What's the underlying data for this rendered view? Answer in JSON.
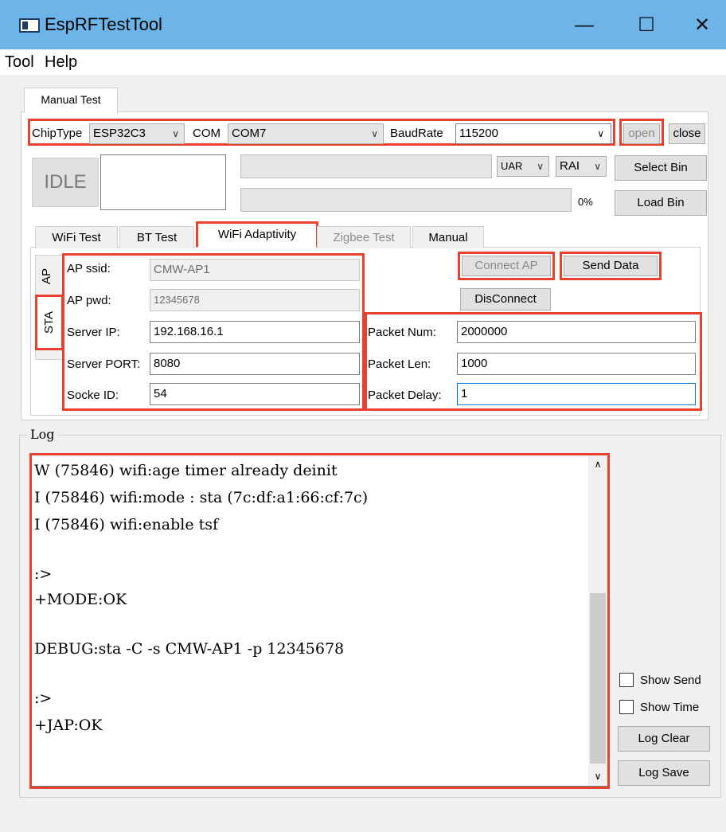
{
  "window": {
    "title": "EspRFTestTool",
    "minimize": "—",
    "maximize": "☐",
    "close": "✕"
  },
  "menu": {
    "tool": "Tool",
    "help": "Help"
  },
  "main_tab": "Manual Test",
  "connection": {
    "chiptype_label": "ChipType",
    "chiptype_value": "ESP32C3",
    "com_label": "COM",
    "com_value": "COM7",
    "baud_label": "BaudRate",
    "baud_value": "115200",
    "open": "open",
    "close": "close"
  },
  "status": {
    "state": "IDLE",
    "uart_select": "UAR",
    "ram_select": "RAI",
    "progress_pct": "0%",
    "progress_value": 0
  },
  "buttons": {
    "select_bin": "Select Bin",
    "load_bin": "Load Bin"
  },
  "sub_tabs": [
    "WiFi Test",
    "BT Test",
    "WiFi Adaptivity",
    "Zigbee Test",
    "Manual"
  ],
  "side_tabs": {
    "ap": "AP",
    "sta": "STA"
  },
  "wifi_form": {
    "ap_ssid_label": "AP ssid:",
    "ap_ssid": "CMW-AP1",
    "ap_pwd_label": "AP pwd:",
    "ap_pwd": "12345678",
    "server_ip_label": "Server IP:",
    "server_ip": "192.168.16.1",
    "server_port_label": "Server PORT:",
    "server_port": "8080",
    "socket_id_label": "Socke ID:",
    "socket_id": "54"
  },
  "packet_form": {
    "num_label": "Packet Num:",
    "num": "2000000",
    "len_label": "Packet Len:",
    "len": "1000",
    "delay_label": "Packet Delay:",
    "delay": "1"
  },
  "wifi_buttons": {
    "connect_ap": "Connect AP",
    "send_data": "Send Data",
    "disconnect": "DisConnect"
  },
  "log": {
    "title": "Log",
    "lines": [
      "W (75846) wifi:age timer already deinit",
      "I (75846) wifi:mode : sta (7c:df:a1:66:cf:7c)",
      "I (75846) wifi:enable tsf",
      "",
      ":>",
      "+MODE:OK",
      "",
      "DEBUG:sta -C -s CMW-AP1 -p 12345678",
      "",
      ":>",
      "+JAP:OK"
    ],
    "show_send": "Show Send",
    "show_time": "Show Time",
    "clear": "Log Clear",
    "save": "Log Save"
  }
}
